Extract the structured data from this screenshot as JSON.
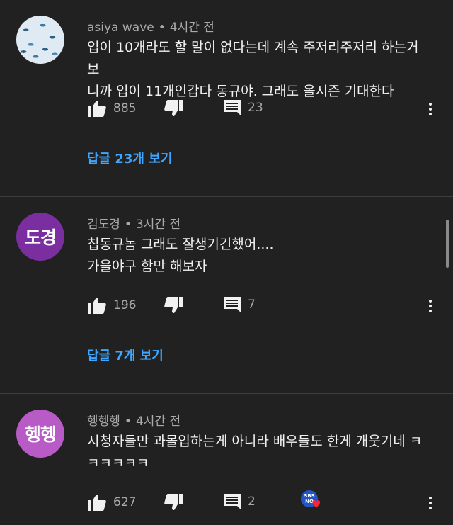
{
  "comments": [
    {
      "author": "asiya wave",
      "time": "4시간 전",
      "text_lines": [
        "입이 10개라도 할 말이 없다는데 계속 주저리주저리 하는거 보",
        "니까 입이 11개인갑다 동규야. 그래도 올시즌 기대한다"
      ],
      "likes": "885",
      "replies_count": "23",
      "replies_link": "답글 23개 보기"
    },
    {
      "author": "김도경",
      "avatar_text": "도경",
      "avatar_color": "#7b2ea0",
      "time": "3시간 전",
      "text_lines": [
        "칩동규놈 그래도 잘생기긴했어....",
        "가을야구 함만 해보자"
      ],
      "likes": "196",
      "replies_count": "7",
      "replies_link": "답글 7개 보기"
    },
    {
      "author": "헹헹헹",
      "avatar_text": "헹헹",
      "avatar_color": "#b85bc6",
      "time": "4시간 전",
      "text_lines": [
        "시청자들만 과몰입하는게 아니라 배우들도 한게 개웃기네 ㅋ",
        "ㅋㅋㅋㅋㅋ"
      ],
      "likes": "627",
      "replies_count": "2",
      "badge_text": "SBS",
      "badge_sub": "NO"
    }
  ],
  "separator": "•",
  "colors": {
    "background": "#212121",
    "link": "#3ea6ff",
    "muted": "#aaaaaa"
  },
  "icons": {
    "like": "thumbs-up-icon",
    "dislike": "thumbs-down-icon",
    "reply": "comment-icon",
    "more": "more-vert-icon"
  }
}
